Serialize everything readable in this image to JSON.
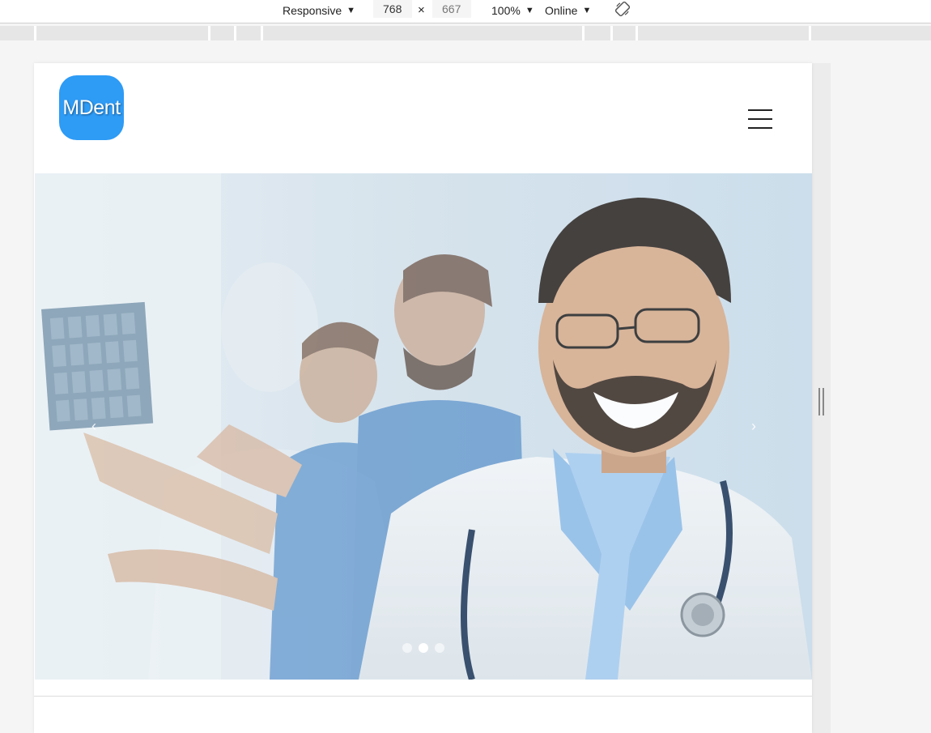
{
  "devtools": {
    "device_label": "Responsive",
    "width_value": "768",
    "height_placeholder": "667",
    "times_symbol": "×",
    "zoom_label": "100%",
    "throttle_label": "Online",
    "dropdown_arrow": "▼"
  },
  "site": {
    "logo_text": "MDent",
    "brand_color": "#2e9bf5"
  },
  "carousel": {
    "prev_glyph": "‹",
    "next_glyph": "›",
    "slide_count": 3,
    "active_slide": 2
  },
  "icons": [
    "rotate-icon",
    "hamburger-menu-icon",
    "chevron-left-icon",
    "chevron-right-icon"
  ]
}
